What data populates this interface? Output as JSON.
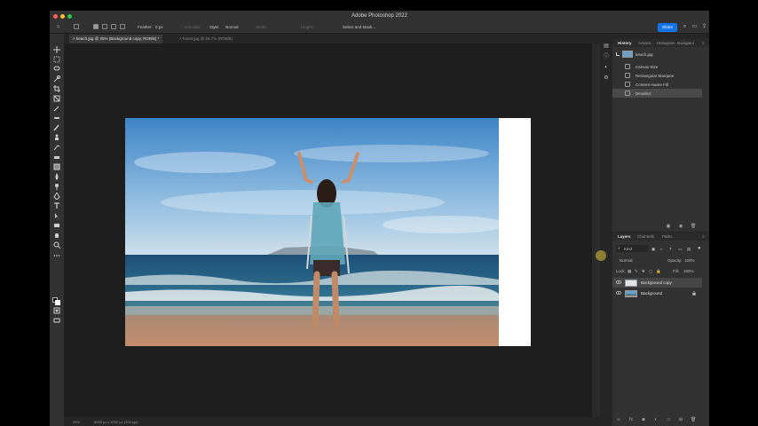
{
  "window": {
    "title": "Adobe Photoshop 2022",
    "traffic_lights": [
      "#ff5f57",
      "#febc2e",
      "#28c840"
    ]
  },
  "options_bar": {
    "feather_label": "Feather:",
    "feather_value": "0 px",
    "antialias_label": "Anti-alias",
    "style_label": "Style:",
    "style_value": "Normal",
    "width_label": "Width:",
    "height_label": "Height:",
    "select_mask_label": "Select and Mask...",
    "share_label": "Share"
  },
  "doc_tabs": [
    {
      "label": "beach.jpg @ 25% (Background copy, RGB/8) *",
      "close": "×"
    },
    {
      "label": "forest.jpg @ 66.7% (RGB/8)",
      "close": "×"
    }
  ],
  "status": {
    "zoom": "25%",
    "doc_info": "8000 px x 4760 px (300 ppi)"
  },
  "history_panel": {
    "tabs": [
      "History",
      "Actions",
      "Histogram",
      "Navigator"
    ],
    "snapshot": "beach.jpg",
    "steps": [
      "Canvas Size",
      "Rectangular Marquee",
      "Content-Aware Fill",
      "Deselect"
    ]
  },
  "layers_panel": {
    "tabs": [
      "Layers",
      "Channels",
      "Paths"
    ],
    "filter_kind": "Kind",
    "blend_mode": "Normal",
    "opacity_label": "Opacity:",
    "opacity_value": "100%",
    "lock_label": "Lock:",
    "fill_label": "Fill:",
    "fill_value": "100%",
    "layers": [
      {
        "name": "Background copy",
        "selected": true
      },
      {
        "name": "Background",
        "selected": false
      }
    ]
  },
  "colors": {
    "accent": "#1473e6",
    "foreground_swatch": "#000000",
    "background_swatch": "#ffffff"
  }
}
